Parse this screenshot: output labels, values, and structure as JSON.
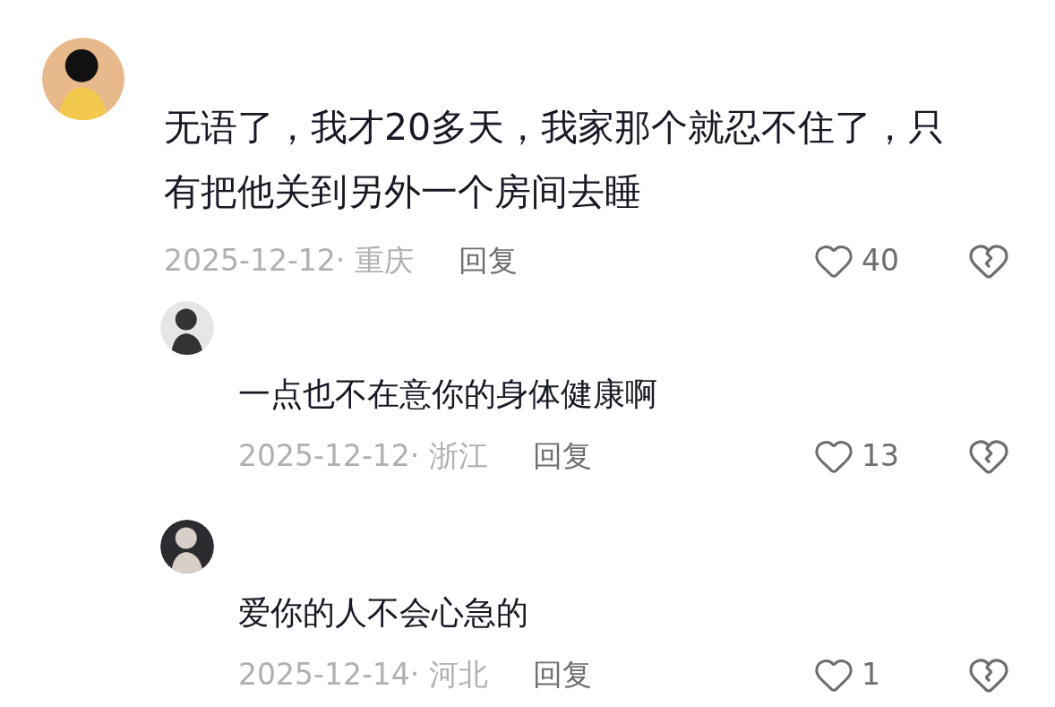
{
  "comments": [
    {
      "text": "无语了，我才20多天，我家那个就忍不住了，只有把他关到另外一个房间去睡",
      "meta": "2025-12-12· 重庆",
      "reply_label": "回复",
      "likes": "40",
      "children": [
        {
          "text": "一点也不在意你的身体健康啊",
          "meta": "2025-12-12· 浙江",
          "reply_label": "回复",
          "likes": "13"
        },
        {
          "text": "爱你的人不会心急的",
          "meta": "2025-12-14· 河北",
          "reply_label": "回复",
          "likes": "1"
        }
      ]
    }
  ]
}
